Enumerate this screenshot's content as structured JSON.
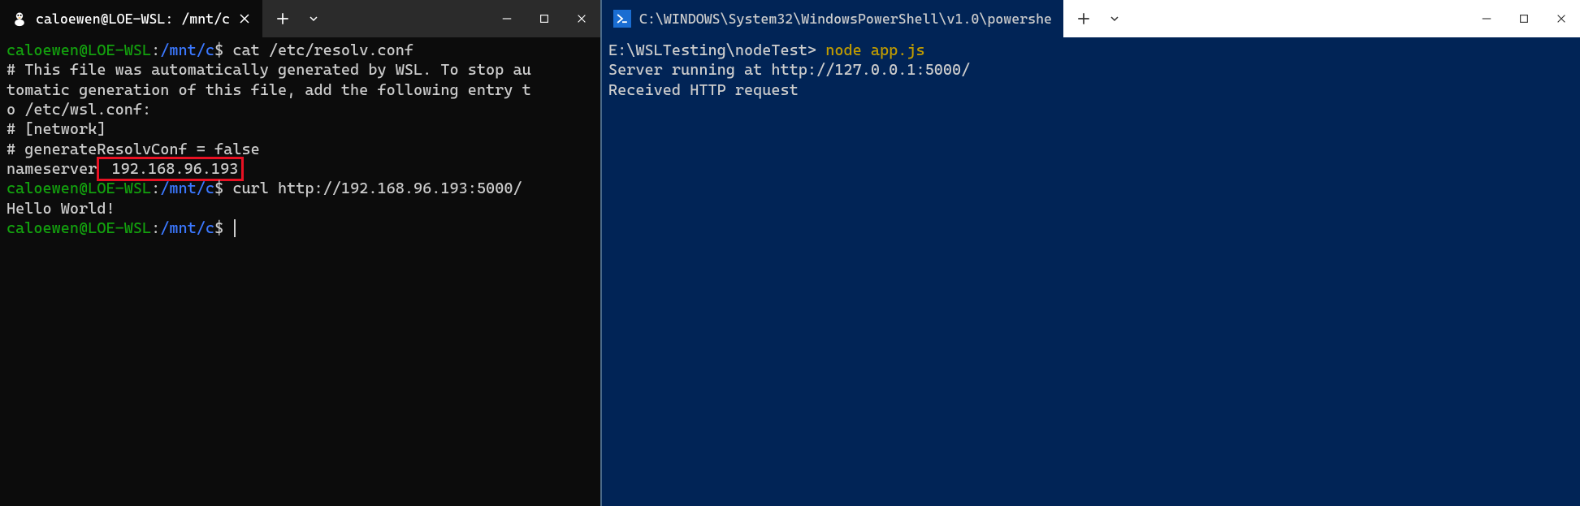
{
  "left": {
    "tab": {
      "title": "caloewen@LOE-WSL: /mnt/c"
    },
    "prompt": {
      "user": "caloewen@LOE-WSL",
      "colon": ":",
      "path": "/mnt/c",
      "dollar": "$"
    },
    "cmd1": " cat /etc/resolv.conf",
    "out1_line1": "# This file was automatically generated by WSL. To stop au",
    "out1_line2": "tomatic generation of this file, add the following entry t",
    "out1_line3": "o /etc/wsl.conf:",
    "out1_line4": "# [network]",
    "out1_line5": "# generateResolvConf = false",
    "out1_nameserver_label": "nameserver",
    "out1_nameserver_ip": " 192.168.96.193",
    "cmd2": " curl http://192.168.96.193:5000/",
    "out2": "Hello World!"
  },
  "right": {
    "tab": {
      "title": "C:\\WINDOWS\\System32\\WindowsPowerShell\\v1.0\\powershe"
    },
    "prompt_path": "E:\\WSLTesting\\nodeTest>",
    "cmd": " node app.js",
    "out_line1": "Server running at http://127.0.0.1:5000/",
    "out_line2": "Received HTTP request"
  }
}
